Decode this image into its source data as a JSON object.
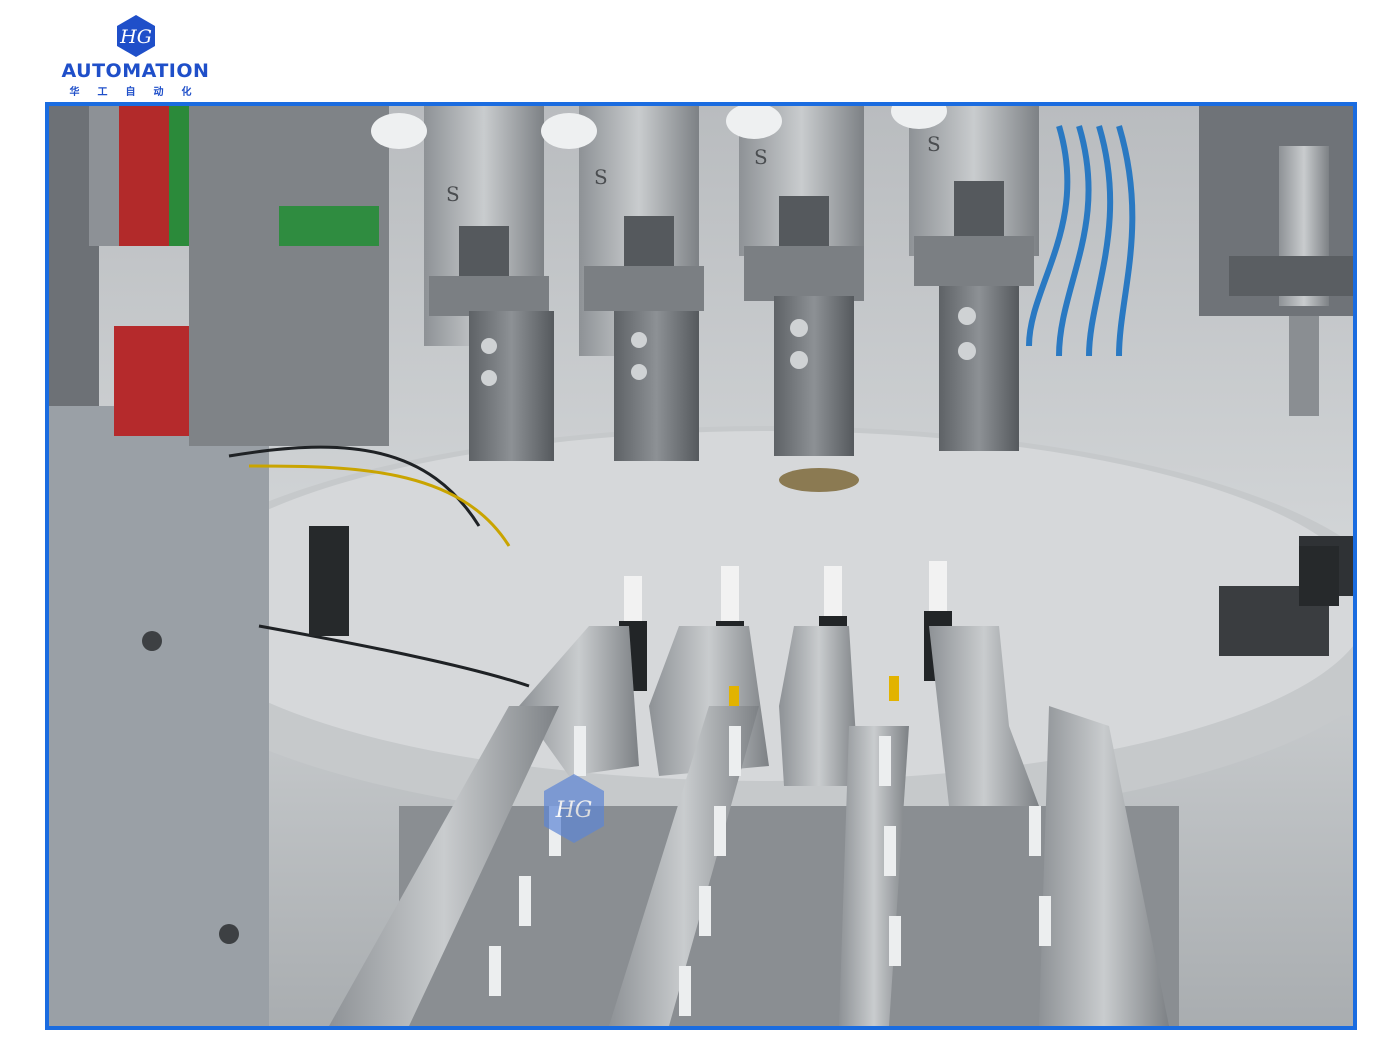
{
  "logo": {
    "mark_text": "HG",
    "wordmark": "AUTOMATION",
    "chinese": "华工自动化",
    "brand_color": "#1f4fc9"
  },
  "photo": {
    "frame_color": "#1a6ce0",
    "gripper_labels": [
      "S",
      "S",
      "S",
      "S"
    ],
    "watermark_text": "HG"
  }
}
